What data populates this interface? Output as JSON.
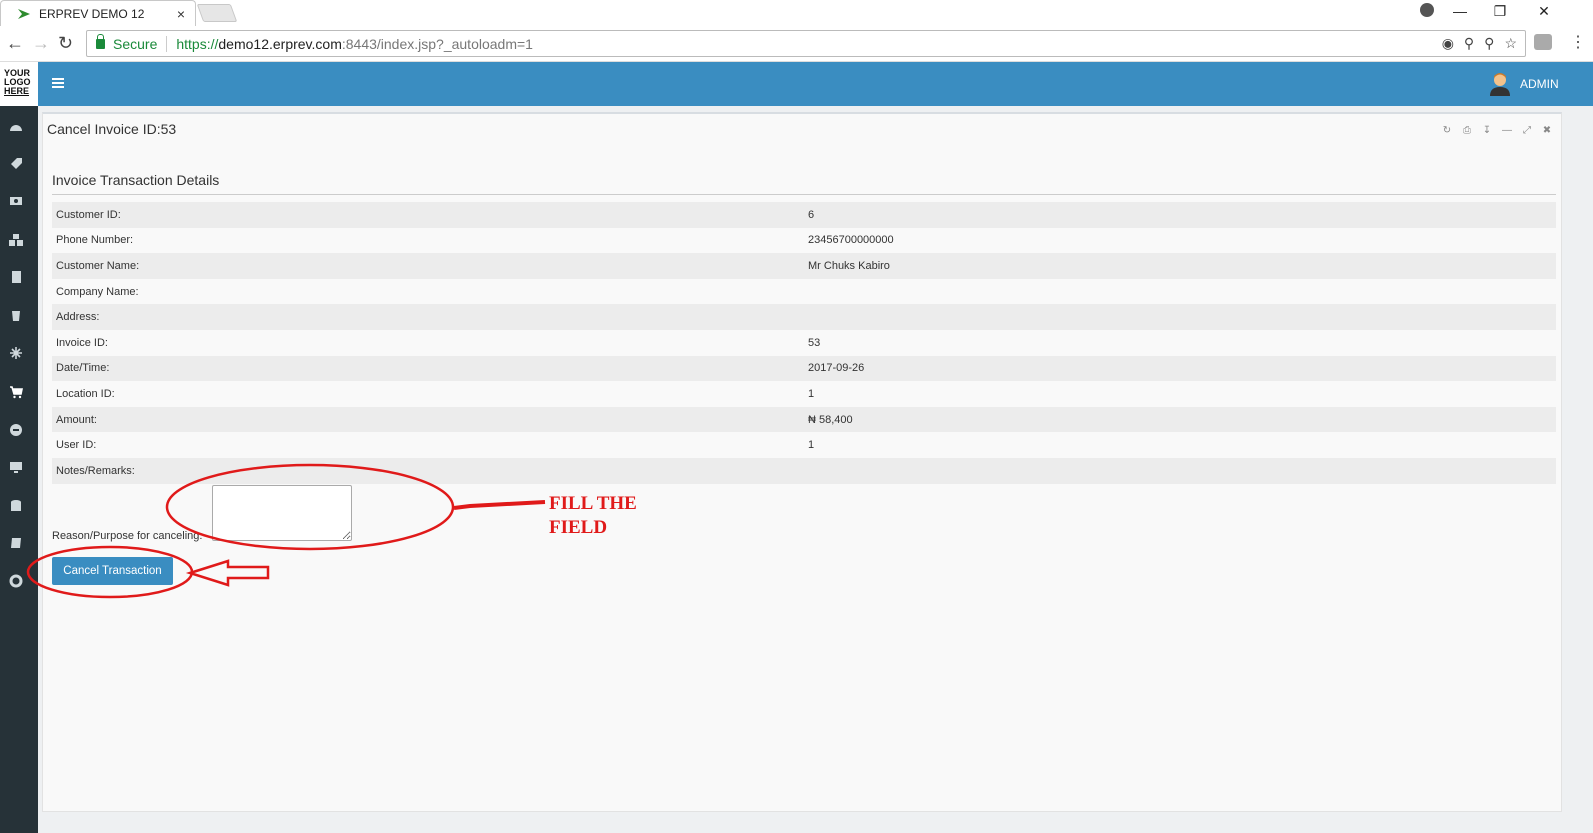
{
  "browser": {
    "tab_title": "ERPREV DEMO 12",
    "tab_close": "×",
    "secure_label": "Secure",
    "url_scheme": "https://",
    "url_host": "demo12.erprev.com",
    "url_path": ":8443/index.jsp?_autoloadm=1"
  },
  "app": {
    "logo_lines": [
      "YOUR",
      "LOGO",
      "HERE"
    ],
    "user_label": "ADMIN",
    "accent_color": "#3a8dc1",
    "sidebar_color": "#263238"
  },
  "panel": {
    "title": "Cancel Invoice ID:53",
    "section_title": "Invoice Transaction Details",
    "rows": [
      {
        "label": "Customer ID:",
        "value": "6"
      },
      {
        "label": "Phone Number:",
        "value": "23456700000000"
      },
      {
        "label": "Customer Name:",
        "value": "Mr Chuks Kabiro"
      },
      {
        "label": "Company Name:",
        "value": ""
      },
      {
        "label": "Address:",
        "value": ""
      },
      {
        "label": "Invoice ID:",
        "value": "53"
      },
      {
        "label": "Date/Time:",
        "value": "2017-09-26"
      },
      {
        "label": "Location ID:",
        "value": "1"
      },
      {
        "label": "Amount:",
        "value": "₦ 58,400"
      },
      {
        "label": "User ID:",
        "value": "1"
      },
      {
        "label": "Notes/Remarks:",
        "value": ""
      }
    ],
    "reason_label": "Reason/Purpose for canceling:",
    "reason_value": "",
    "cancel_button": "Cancel Transaction"
  },
  "annotation": {
    "note_line1": "FILL THE",
    "note_line2": "FIELD",
    "color": "#e01a1a"
  }
}
